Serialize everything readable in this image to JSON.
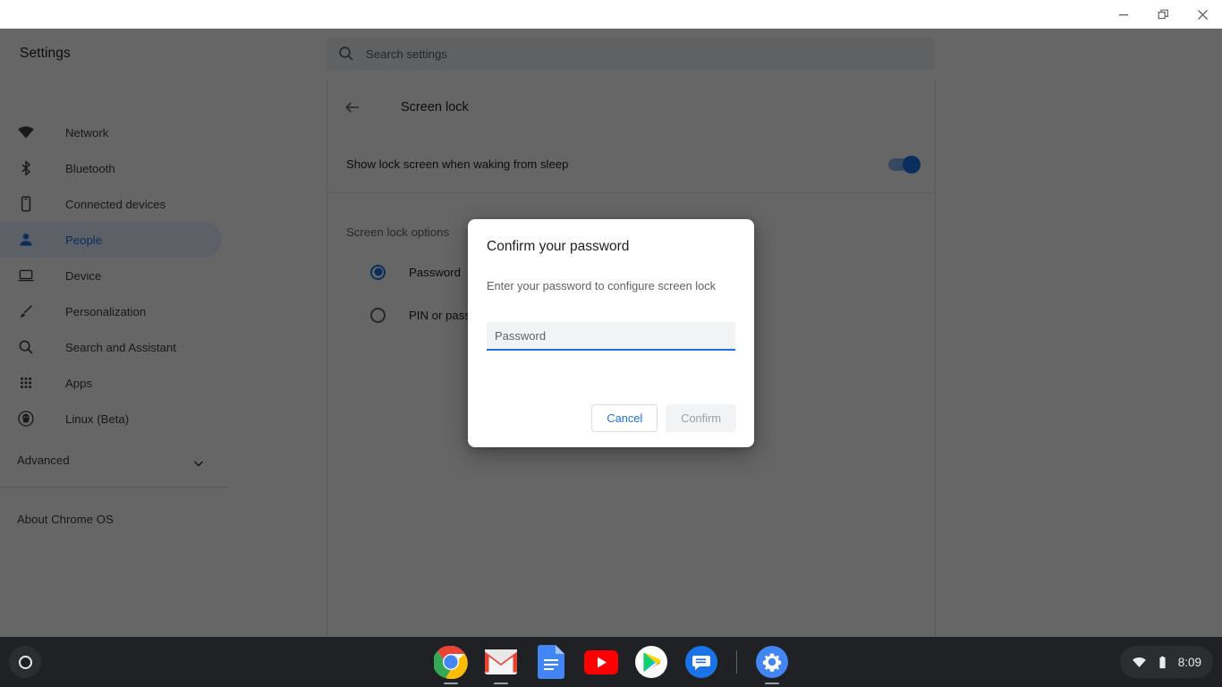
{
  "window": {
    "controls": [
      {
        "name": "minimize",
        "glyph": "minimize-icon"
      },
      {
        "name": "restore",
        "glyph": "restore-icon"
      },
      {
        "name": "close",
        "glyph": "close-icon"
      }
    ]
  },
  "app": {
    "title": "Settings"
  },
  "search": {
    "placeholder": "Search settings",
    "icon": "search-icon"
  },
  "sidebar": {
    "items": [
      {
        "label": "Network",
        "icon": "wifi-icon",
        "selected": false
      },
      {
        "label": "Bluetooth",
        "icon": "bluetooth-icon",
        "selected": false
      },
      {
        "label": "Connected devices",
        "icon": "phone-icon",
        "selected": false
      },
      {
        "label": "People",
        "icon": "person-icon",
        "selected": true
      },
      {
        "label": "Device",
        "icon": "laptop-icon",
        "selected": false
      },
      {
        "label": "Personalization",
        "icon": "brush-icon",
        "selected": false
      },
      {
        "label": "Search and Assistant",
        "icon": "search-icon",
        "selected": false
      },
      {
        "label": "Apps",
        "icon": "grid-apps-icon",
        "selected": false
      },
      {
        "label": "Linux (Beta)",
        "icon": "penguin-icon",
        "selected": false
      }
    ],
    "advanced": {
      "label": "Advanced",
      "icon": "chevron-down-icon"
    },
    "about": {
      "label": "About Chrome OS"
    }
  },
  "main": {
    "back_icon": "arrow-back-icon",
    "page_title": "Screen lock",
    "lock_on_wake": {
      "label": "Show lock screen when waking from sleep",
      "enabled": true
    },
    "options_title": "Screen lock options",
    "options": [
      {
        "label": "Password",
        "selected": true
      },
      {
        "label": "PIN or password",
        "selected": false
      }
    ]
  },
  "dialog": {
    "title": "Confirm your password",
    "subtitle": "Enter your password to configure screen lock",
    "password_field": {
      "value": "",
      "placeholder": "Password"
    },
    "cancel_label": "Cancel",
    "confirm_label": "Confirm",
    "confirm_disabled": true
  },
  "shelf": {
    "launcher": "launcher-icon",
    "apps": [
      {
        "name": "chrome",
        "label": "Chrome",
        "running": true
      },
      {
        "name": "gmail",
        "label": "Gmail",
        "running": true
      },
      {
        "name": "docs",
        "label": "Docs",
        "running": false
      },
      {
        "name": "youtube",
        "label": "YouTube",
        "running": false
      },
      {
        "name": "play-store",
        "label": "Play Store",
        "running": false
      },
      {
        "name": "messages",
        "label": "Messages",
        "running": false
      },
      {
        "name": "settings",
        "label": "Settings",
        "running": true
      }
    ],
    "tray": {
      "wifi_icon": "wifi-icon",
      "battery_icon": "battery-icon",
      "clock": "8:09"
    }
  },
  "colors": {
    "accent": "#1a73e8",
    "accent_light": "#8ab4f8",
    "selected_bg": "#e8f0fe",
    "text_primary": "#202124",
    "text_secondary": "#5f6368",
    "shelf_bg": "#202124",
    "scrim": "rgba(0,0,0,0.60)"
  }
}
